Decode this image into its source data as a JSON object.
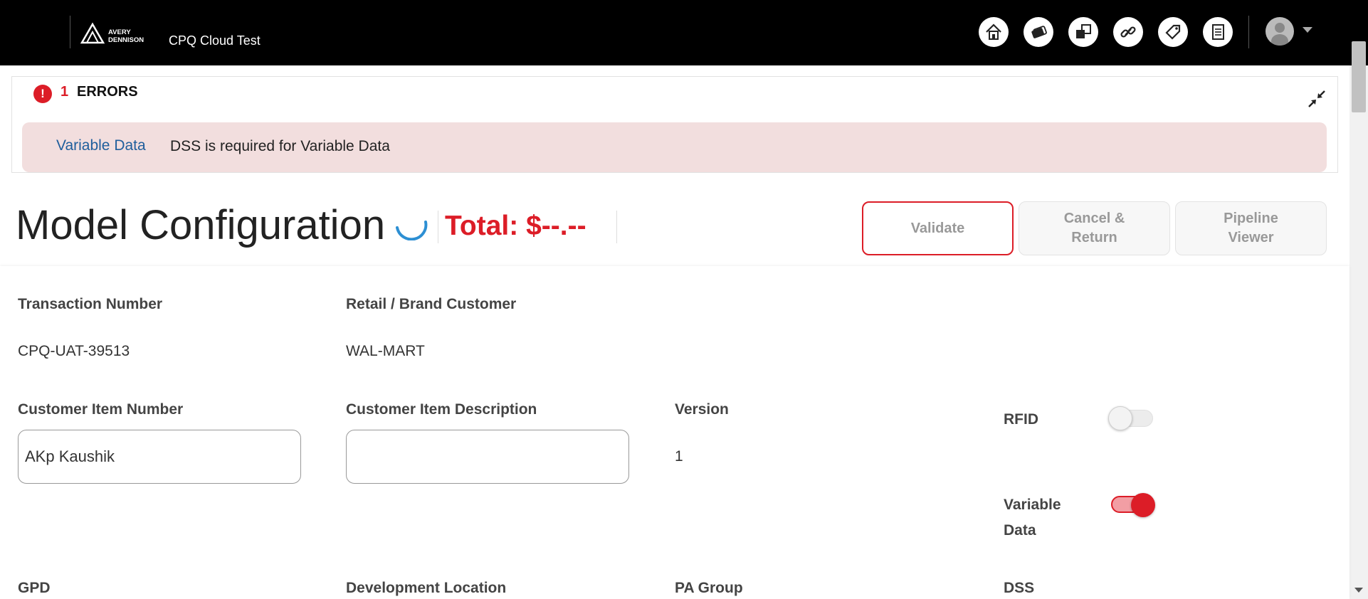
{
  "header": {
    "logo_line1": "AVERY",
    "logo_line2": "DENNISON",
    "app_title": "CPQ Cloud Test",
    "nav_icons": [
      "home-icon",
      "quotes-icon",
      "configurator-icon",
      "links-icon",
      "tag-icon",
      "documents-icon"
    ],
    "avatar_icon": "user-avatar-icon"
  },
  "errors": {
    "count": "1",
    "label": "ERRORS",
    "items": [
      {
        "link": "Variable Data",
        "message": "DSS is required for Variable Data"
      }
    ]
  },
  "page": {
    "title": "Model Configuration",
    "total": "Total: $--.--"
  },
  "actions": {
    "validate": "Validate",
    "cancel_return": "Cancel & Return",
    "pipeline_viewer": "Pipeline Viewer"
  },
  "form": {
    "transaction_number": {
      "label": "Transaction Number",
      "value": "CPQ-UAT-39513"
    },
    "retail_brand_customer": {
      "label": "Retail / Brand Customer",
      "value": "WAL-MART"
    },
    "customer_item_number": {
      "label": "Customer Item Number",
      "value": "AKp Kaushik",
      "placeholder": ""
    },
    "customer_item_description": {
      "label": "Customer Item Description",
      "value": "",
      "placeholder": ""
    },
    "version": {
      "label": "Version",
      "value": "1"
    },
    "rfid": {
      "label": "RFID",
      "checked": false
    },
    "variable_data": {
      "label": "Variable Data",
      "checked": true
    },
    "gpd": {
      "label": "GPD"
    },
    "development_location": {
      "label": "Development Location"
    },
    "pa_group": {
      "label": "PA Group"
    },
    "dss": {
      "label": "DSS"
    }
  },
  "colors": {
    "accent_red": "#dc1d27",
    "error_banner_bg": "#f2dede",
    "link_blue": "#1f5e9c",
    "topbar_bg": "#000000"
  }
}
